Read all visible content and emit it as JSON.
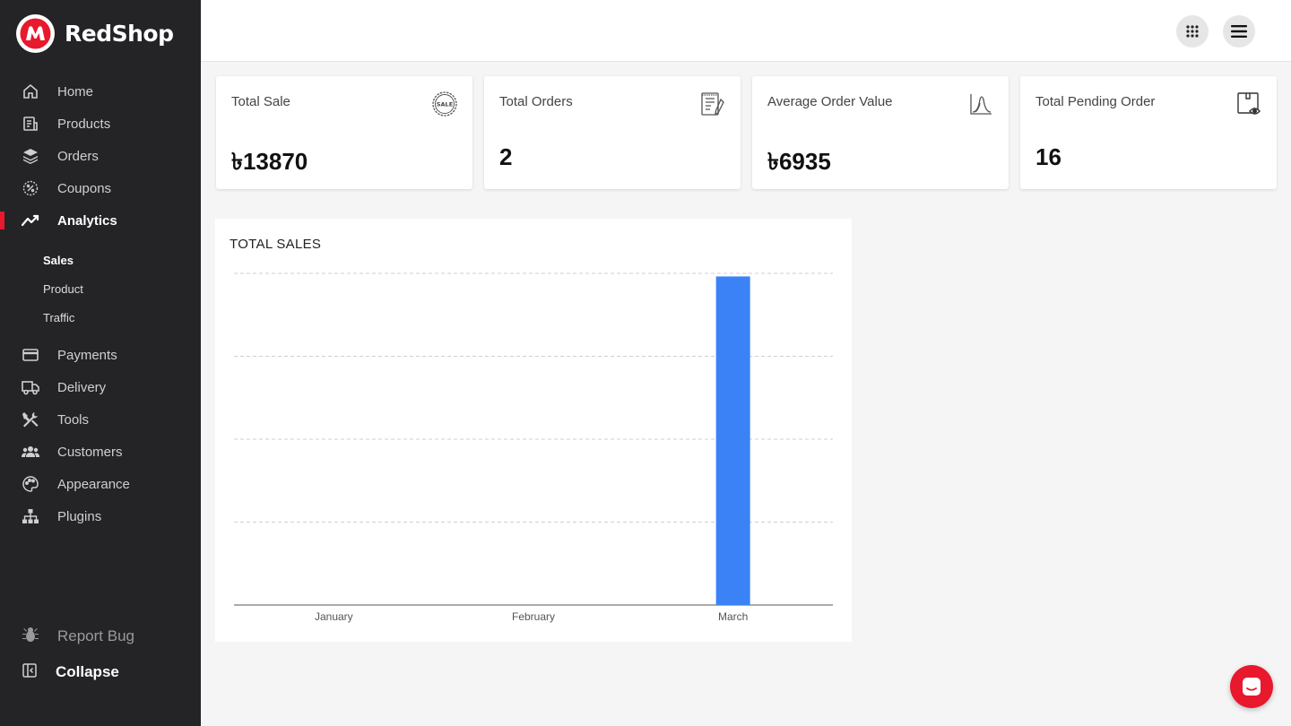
{
  "brand": {
    "name": "RedShop"
  },
  "sidebar": {
    "items": [
      {
        "label": "Home",
        "icon": "home-icon"
      },
      {
        "label": "Products",
        "icon": "products-icon"
      },
      {
        "label": "Orders",
        "icon": "orders-icon"
      },
      {
        "label": "Coupons",
        "icon": "coupon-icon"
      },
      {
        "label": "Analytics",
        "icon": "analytics-icon",
        "active": true
      }
    ],
    "subitems": [
      {
        "label": "Sales",
        "active": true
      },
      {
        "label": "Product"
      },
      {
        "label": "Traffic"
      }
    ],
    "items2": [
      {
        "label": "Payments",
        "icon": "card-icon"
      },
      {
        "label": "Delivery",
        "icon": "truck-icon"
      },
      {
        "label": "Tools",
        "icon": "tools-icon"
      },
      {
        "label": "Customers",
        "icon": "users-icon"
      },
      {
        "label": "Appearance",
        "icon": "palette-icon"
      },
      {
        "label": "Plugins",
        "icon": "sitemap-icon"
      }
    ],
    "report_bug": "Report Bug",
    "collapse": "Collapse"
  },
  "cards": [
    {
      "title": "Total Sale",
      "value": "৳13870",
      "icon": "sale-badge-icon"
    },
    {
      "title": "Total Orders",
      "value": "2",
      "icon": "invoice-icon"
    },
    {
      "title": "Average Order Value",
      "value": "৳6935",
      "icon": "bell-curve-icon"
    },
    {
      "title": "Total Pending Order",
      "value": "16",
      "icon": "pending-view-icon"
    }
  ],
  "colors": {
    "accent": "#e8182d",
    "sidebar_bg": "#242426",
    "bar": "#3b82f6"
  },
  "chart_data": {
    "type": "bar",
    "title": "TOTAL SALES",
    "categories": [
      "January",
      "February",
      "March"
    ],
    "values": [
      0,
      0,
      13870
    ],
    "ylim": [
      0,
      14000
    ],
    "grid": true
  }
}
